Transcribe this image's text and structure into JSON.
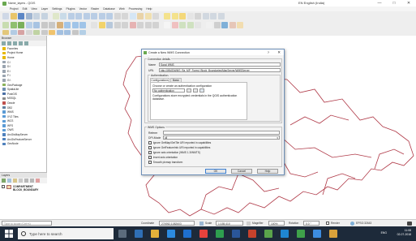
{
  "window": {
    "title": "Name_layers - QGIS",
    "language": "EN English (India)",
    "controls": [
      "—",
      "□",
      "✕"
    ]
  },
  "menu": [
    "Project",
    "Edit",
    "View",
    "Layer",
    "Settings",
    "Plugins",
    "Vector",
    "Raster",
    "Database",
    "Web",
    "Processing",
    "Help"
  ],
  "browser": {
    "header": "Browser",
    "items": [
      {
        "label": "Favorites",
        "color": "#e6b800"
      },
      {
        "label": "Project Home",
        "color": "#e6b800"
      },
      {
        "label": "Home",
        "color": "#e6b800"
      },
      {
        "label": "C:\\",
        "color": "#9aa4b0"
      },
      {
        "label": "D:\\",
        "color": "#9aa4b0"
      },
      {
        "label": "E:\\",
        "color": "#9aa4b0"
      },
      {
        "label": "F:\\",
        "color": "#9aa4b0"
      },
      {
        "label": "G:\\",
        "color": "#9aa4b0"
      },
      {
        "label": "GeoPackage",
        "color": "#8bb35a"
      },
      {
        "label": "SpatiaLite",
        "color": "#6e8fb0"
      },
      {
        "label": "PostGIS",
        "color": "#4a6fa5"
      },
      {
        "label": "MSSQL",
        "color": "#8a8a8a"
      },
      {
        "label": "Oracle",
        "color": "#c0504d"
      },
      {
        "label": "DB2",
        "color": "#5f7f9f"
      },
      {
        "label": "WMS",
        "color": "#5b9bd5"
      },
      {
        "label": "XYZ Tiles",
        "color": "#5b9bd5"
      },
      {
        "label": "WCS",
        "color": "#5b9bd5"
      },
      {
        "label": "WFS",
        "color": "#5b9bd5"
      },
      {
        "label": "OWS",
        "color": "#5b9bd5"
      },
      {
        "label": "ArcGisMapServer",
        "color": "#4f81bd"
      },
      {
        "label": "ArcGisFeatureServer",
        "color": "#4f81bd"
      },
      {
        "label": "GeoNode",
        "color": "#4f81bd"
      }
    ]
  },
  "layers": {
    "header": "Layers",
    "items": [
      {
        "label": "COMPARTMENT BLOCK_BOUNDARY",
        "checked": true
      }
    ]
  },
  "dialog": {
    "title": "Create a New WMS Connection",
    "help_icon": "?",
    "close_icon": "✕",
    "connection_details": "Connection details",
    "name_label": "Name",
    "name_value": "Sauvl WMS",
    "url_label": "URL",
    "url_value": "http://WMS/WMS_Ra_MP_Forest_Block_Boundaries/MapServer/WMSServer",
    "auth_title": "Authentication",
    "tab_config": "Configurations",
    "tab_basic": "Basic",
    "auth_choose": "Choose or create an authentication configuration",
    "auth_select": "No authentication",
    "auth_note": "Configurations store encrypted credentials in the QGIS authentication database.",
    "wms_options": "WMS Options",
    "referer_label": "Referer",
    "dpi_label": "DPI-Mode",
    "dpi_value": "all",
    "checks": [
      "Ignore GetMap/GetTile URI reported in capabilities",
      "Ignore GetFeatureInfo URI reported in capabilities",
      "Ignore axis orientation (WMS 1.3/WMTS)",
      "Invert axis orientation",
      "Smooth pixmap transform"
    ],
    "ok": "OK",
    "cancel": "Cancel",
    "help": "Help"
  },
  "status": {
    "locator_placeholder": "Type to locate (Ctrl+K)",
    "coordinate_label": "Coordinate",
    "coordinate": "274952,1082603",
    "scale_label": "Scale",
    "scale": "1:155,410",
    "magnifier_label": "Magnifier",
    "magnifier": "100%",
    "rotation_label": "Rotation",
    "rotation": "0.0 °",
    "render_label": "Render",
    "crs": "EPSG:32643"
  },
  "taskbar": {
    "search_placeholder": "Type here to search",
    "time": "11:08",
    "date": "02-07-2018",
    "lang": "ENG"
  }
}
